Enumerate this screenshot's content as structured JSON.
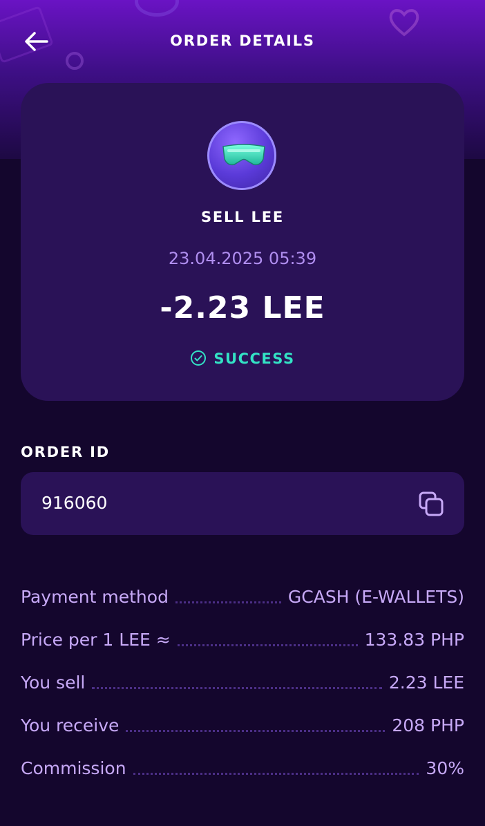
{
  "header": {
    "title": "ORDER DETAILS"
  },
  "card": {
    "operation": "SELL LEE",
    "datetime": "23.04.2025 05:39",
    "amount": "-2.23 LEE",
    "status": "SUCCESS"
  },
  "order": {
    "id_label": "ORDER ID",
    "id_value": "916060"
  },
  "details": [
    {
      "label": "Payment method",
      "value": "GCASH (E-WALLETS)"
    },
    {
      "label": "Price per 1 LEE ≈",
      "value": "133.83 PHP"
    },
    {
      "label": "You sell",
      "value": "2.23 LEE"
    },
    {
      "label": "You receive",
      "value": "208 PHP"
    },
    {
      "label": "Commission",
      "value": "30%"
    }
  ],
  "colors": {
    "background": "#14062d",
    "card": "#2a1257",
    "accent_purple": "#b08ef0",
    "success": "#33e3c5"
  },
  "icons": {
    "back": "arrow-left-icon",
    "avatar": "goggles-icon",
    "status": "check-circle-icon",
    "copy": "copy-icon"
  }
}
